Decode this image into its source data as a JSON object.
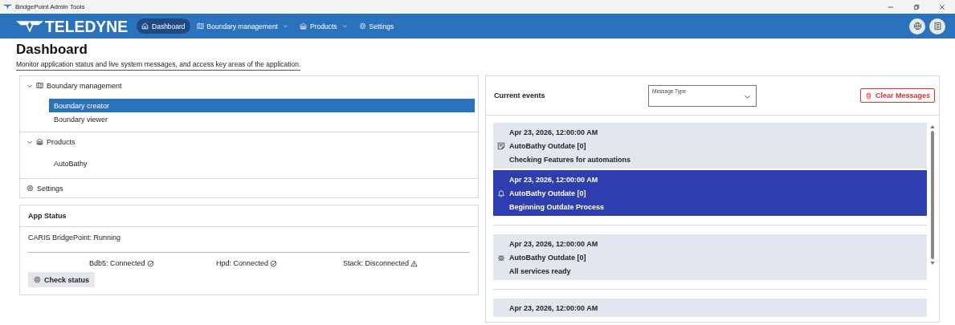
{
  "window": {
    "title": "BridgePoint Admin Tools"
  },
  "nav": {
    "brand": "TELEDYNE",
    "items": [
      {
        "label": "Dashboard",
        "selected": true,
        "has_menu": false
      },
      {
        "label": "Boundary management",
        "selected": false,
        "has_menu": true
      },
      {
        "label": "Products",
        "selected": false,
        "has_menu": true
      },
      {
        "label": "Settings",
        "selected": false,
        "has_menu": false
      }
    ]
  },
  "page": {
    "title": "Dashboard",
    "subtitle": "Monitor application status and live system messages, and access key areas of the application."
  },
  "tree": [
    {
      "label": "Boundary management",
      "expanded": true,
      "children": [
        {
          "label": "Boundary creator",
          "selected": true
        },
        {
          "label": "Boundary viewer",
          "selected": false
        }
      ]
    },
    {
      "label": "Products",
      "expanded": true,
      "children": [
        {
          "label": "AutoBathy",
          "selected": false
        }
      ]
    },
    {
      "label": "Settings",
      "expanded": false
    }
  ],
  "app_status": {
    "title": "App Status",
    "summary": "CARIS BridgePoint: Running",
    "services": [
      {
        "label": "Bdb5: Connected",
        "connected": true
      },
      {
        "label": "Hpd: Connected",
        "connected": true
      },
      {
        "label": "Stack: Disconnected",
        "connected": false
      }
    ],
    "button": "Check status"
  },
  "events": {
    "title": "Current events",
    "filter": {
      "label": "Message Type"
    },
    "clear_button": "Clear Messages",
    "items": [
      {
        "kind": "note",
        "time": "Apr 23, 2026, 12:00:00 AM",
        "source": "AutoBathy Outdate [0]",
        "message": "Checking Features for automations",
        "selected": false
      },
      {
        "kind": "bell",
        "time": "Apr 23, 2026, 12:00:00 AM",
        "source": "AutoBathy Outdate [0]",
        "message": "Beginning Outdate Process",
        "selected": true
      },
      {
        "kind": "bug",
        "time": "Apr 23, 2026, 12:00:00 AM",
        "source": "AutoBathy Outdate [0]",
        "message": "All services ready",
        "selected": false
      },
      {
        "time": "Apr 23, 2026, 12:00:00 AM",
        "selected": false
      }
    ]
  }
}
